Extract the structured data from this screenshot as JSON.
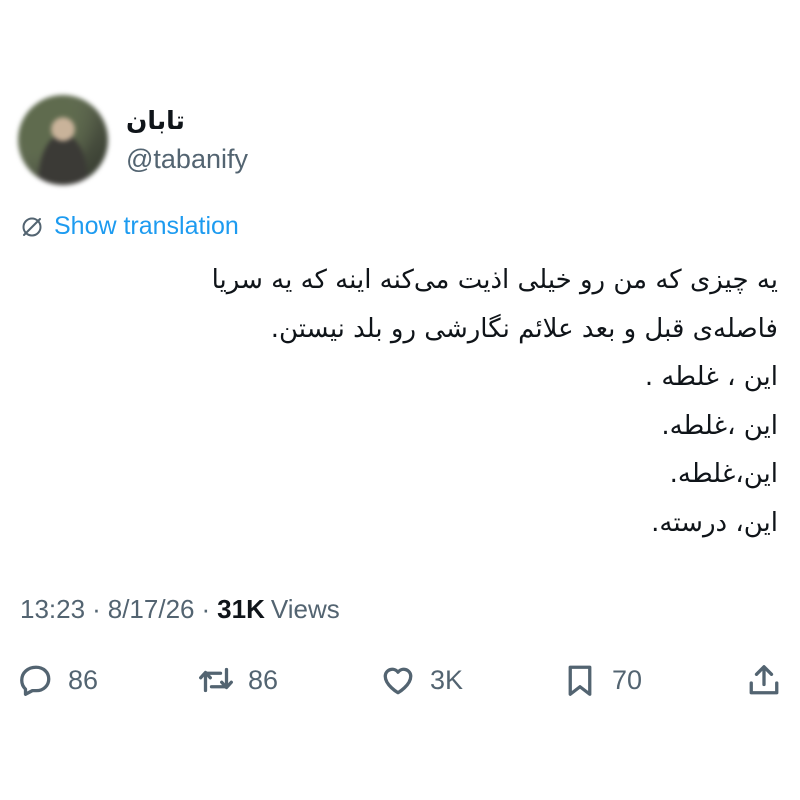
{
  "author": {
    "display_name": "تابان",
    "handle": "@tabanify"
  },
  "translation_link": "Show translation",
  "tweet_lines": [
    "یه چیزی که من رو خیلی اذیت می‌کنه اینه که یه سریا",
    "فاصله‌ی قبل و بعد علائم نگارشی رو بلد نیستن.",
    "این ، غلطه .",
    "این ،غلطه.",
    "این،غلطه.",
    "این، درسته."
  ],
  "meta": {
    "time": "13:23",
    "date": "8/17/26",
    "views_count": "31K",
    "views_label": "Views"
  },
  "actions": {
    "reply_count": "86",
    "retweet_count": "86",
    "like_count": "3K",
    "bookmark_count": "70"
  },
  "colors": {
    "link": "#1d9bf0",
    "secondary_text": "#536471",
    "primary_text": "#0f1419"
  },
  "icons": [
    "reply-icon",
    "retweet-icon",
    "like-icon",
    "bookmark-icon",
    "share-icon",
    "translate-icon"
  ]
}
